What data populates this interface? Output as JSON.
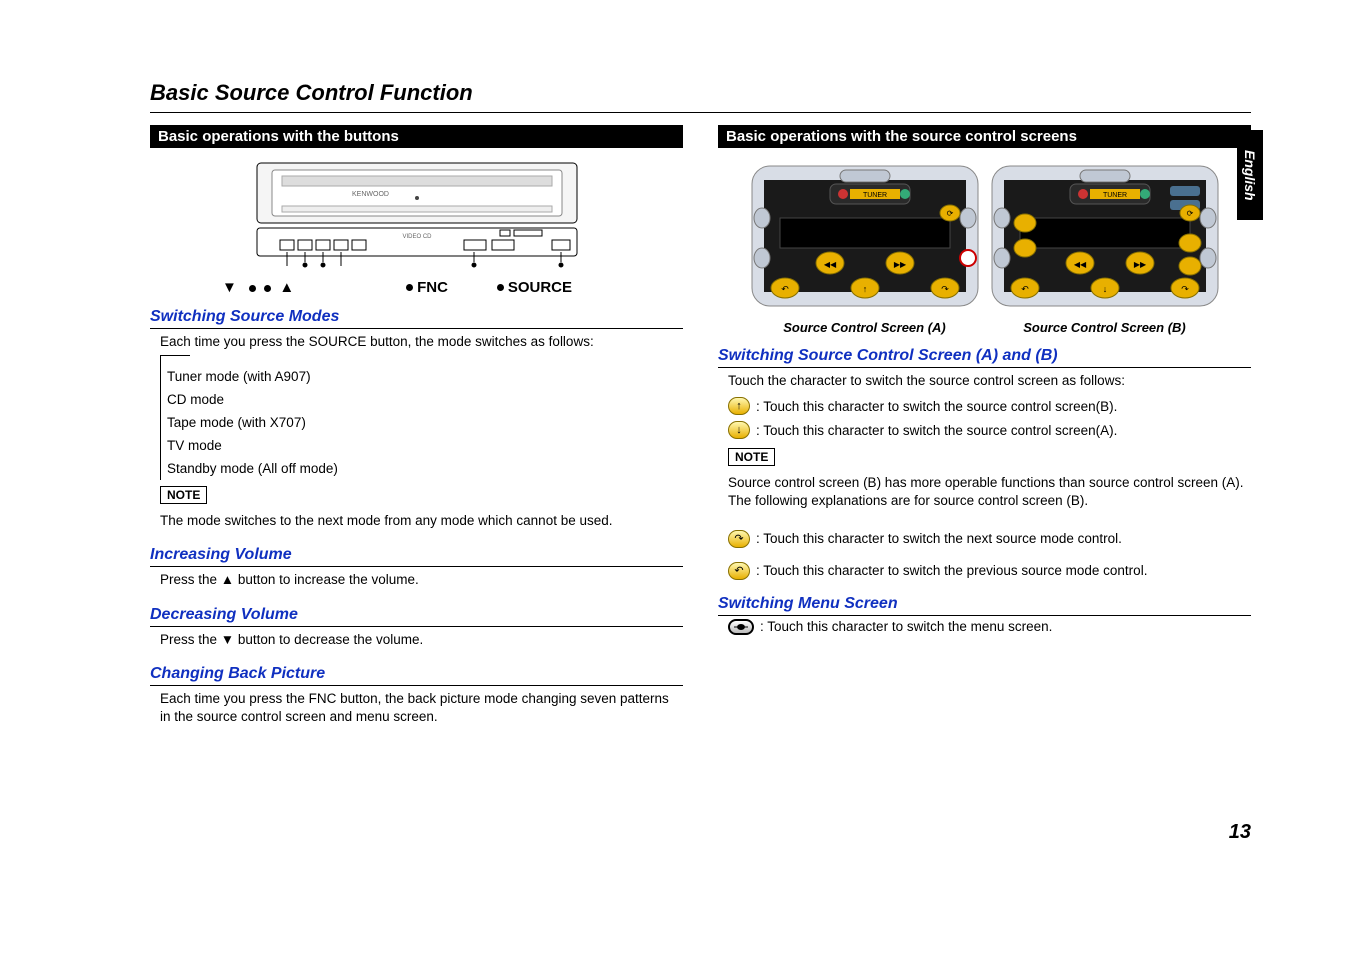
{
  "language_tab": "English",
  "page_num": "13",
  "main_title": "Basic Source Control Function",
  "left": {
    "bar": "Basic operations with the buttons",
    "legend": {
      "triangles": "▼▲",
      "fnc": "FNC",
      "source": "SOURCE"
    },
    "switch_modes": {
      "title": "Switching Source Modes",
      "intro": "Each time you press the SOURCE button, the mode switches as follows:",
      "modes": [
        "Tuner mode (with A907)",
        "CD mode",
        "Tape mode (with X707)",
        "TV mode",
        "Standby mode (All off mode)"
      ]
    },
    "note_label": "NOTE",
    "note_text": "The mode switches to the next mode from any mode which cannot be used.",
    "inc_vol": {
      "title": "Increasing Volume",
      "text": "Press the ▲ button to increase the volume."
    },
    "dec_vol": {
      "title": "Decreasing Volume",
      "text": "Press the ▼ button to decrease the volume."
    },
    "back_pic": {
      "title": "Changing Back Picture",
      "text": "Each time you press the FNC button, the back picture mode changing seven patterns in the source control screen and menu screen."
    }
  },
  "right": {
    "bar": "Basic operations with the source control screens",
    "captions": {
      "a": "Source Control Screen (A)",
      "b": "Source Control Screen (B)"
    },
    "switch_ab": {
      "title": "Switching Source Control Screen (A) and (B)",
      "intro": "Touch the character to switch the source control screen as follows:",
      "up": ": Touch this character to switch the source control screen(B).",
      "down": ": Touch this character to switch the source control screen(A).",
      "note_label": "NOTE",
      "note_text": "Source control screen (B) has more operable functions than source control screen (A).  The following explanations are for source control screen (B).",
      "next": ": Touch this character to switch the next source mode control.",
      "prev": ": Touch this character to switch the previous source mode control."
    },
    "menu": {
      "title": "Switching Menu Screen",
      "text": ": Touch this character to switch the menu screen."
    }
  }
}
